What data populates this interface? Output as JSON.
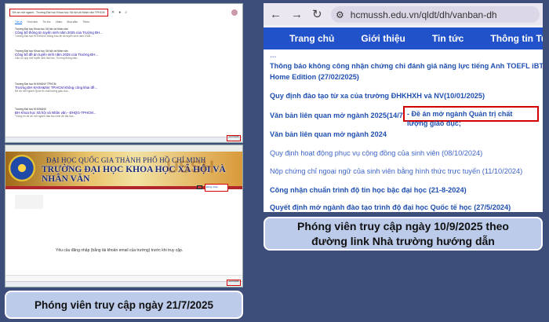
{
  "google": {
    "address_text": "Đề án mở ngành - Trường Đại học Khoa học Xã hội và Nhân văn TPHCM",
    "tabs": [
      "Tất cả",
      "Hình ảnh",
      "Tin tức",
      "Video",
      "Mua sắm",
      "Thêm"
    ],
    "results": [
      {
        "site": "Trường Đại học Khoa học Xã hội và Nhân văn",
        "title": "Công bố thông tin tuyển sinh năm 2025 của Trường ĐH...",
        "desc": "Trường Đại học KHXH&NV thông báo đề án tuyển sinh năm 2025..."
      },
      {
        "site": "Trường Đại học Khoa học Xã hội và Nhân văn",
        "title": "Công bố đề án tuyển sinh năm 2025 của Trường ĐH...",
        "desc": "Căn cứ quy chế tuyển sinh đại học, Trường thông báo..."
      },
      {
        "site": "Trường Đại học KHXH&NV TPHCM",
        "title": "Trường ĐH KHXH&NV TP.HCM không công khai đề...",
        "desc": "Đề án mở ngành Quản trị chất lượng giáo dục..."
      },
      {
        "site": "Trường Đại học KHXH&NV",
        "title": "ĐH Khoa học Xã hội và Nhân văn - ĐHQG-TPHCM...",
        "desc": "Thông tin đề án mở ngành đào tạo trình độ đại học..."
      }
    ],
    "clock": "21/07/2025"
  },
  "site": {
    "univ_line1": "ĐẠI HỌC QUỐC GIA THÀNH PHỐ HỒ CHÍ MINH",
    "univ_line2": "TRƯỜNG ĐẠI HỌC KHOA HỌC XÃ HỘI VÀ NHÂN VĂN",
    "watermark": "USSH",
    "login_label": "Đăng nhập",
    "notice": "Yêu cầu đăng nhập (bằng tài khoản email của trường) trước khi truy cập.",
    "clock": "21/07/2025"
  },
  "browser": {
    "url": "hcmussh.edu.vn/qldt/dh/vanban-dh",
    "menu": [
      "Trang chủ",
      "Giới thiệu",
      "Tin tức",
      "Thông tin Tuyể"
    ],
    "items": [
      {
        "text": "Thông báo không công nhận chứng chỉ đánh giá năng lực tiếng Anh TOEFL iBT theo hình thức thi",
        "style": "bold"
      },
      {
        "text": "Home Edition (27/02/2025)",
        "style": "bold"
      },
      {
        "text": "Quy định đào tạo từ xa của trường ĐHKHXH và NV(10/01/2025)",
        "style": "bold"
      },
      {
        "text": "Văn bản liên quan mở ngành 2025(14/7/2025):",
        "style": "bold"
      },
      {
        "text": "Văn bản liên quan mở ngành 2024",
        "style": "bold"
      },
      {
        "text": "Quy định hoạt động phục vụ cộng đồng của sinh viên (08/10/2024)",
        "style": "norm"
      },
      {
        "text": "Nộp chứng chỉ ngoại ngữ của sinh viên bằng hình thức trực tuyến (11/10/2024)",
        "style": "norm"
      },
      {
        "text": "Công nhận chuẩn trình độ tin học bậc đại học (21-8-2024)",
        "style": "bold"
      },
      {
        "text": "Quyết định mở ngành đào tạo trình độ đại học Quốc tế học (27/5/2024)",
        "style": "bold"
      }
    ],
    "highlight": "- Đề án mở ngành Quản trị chất lượng giáo dục;"
  },
  "captions": {
    "left": "Phóng viên truy cập ngày 21/7/2025",
    "right_line1": "Phóng viên truy cập ngày 10/9/2025 theo",
    "right_line2": "đường link Nhà trường hướng dẫn"
  },
  "colors": {
    "background": "#3d4e7b",
    "menu": "#2252c9",
    "highlight_border": "#d40000",
    "caption_bg": "#bccbea"
  }
}
